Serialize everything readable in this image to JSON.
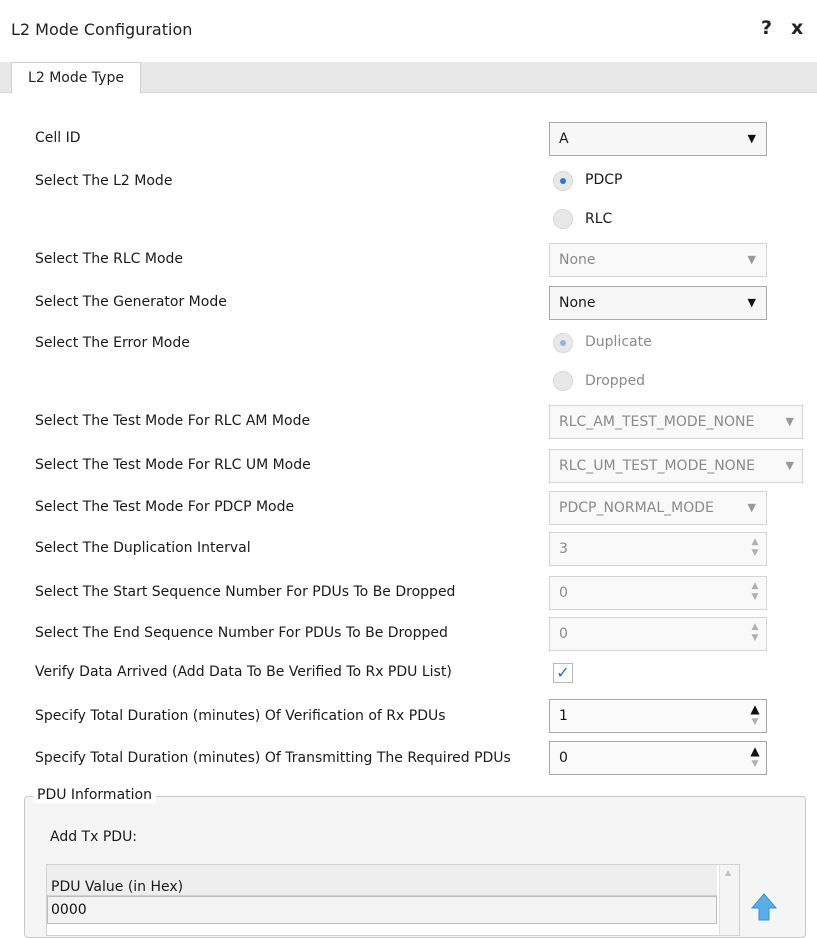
{
  "window": {
    "title": "L2 Mode Configuration",
    "help": "?",
    "close": "x"
  },
  "tabs": [
    {
      "label": "L2 Mode Type",
      "active": true
    }
  ],
  "form": {
    "cell_id": {
      "label": "Cell ID",
      "value": "A"
    },
    "l2_mode": {
      "label": "Select The L2 Mode",
      "options": [
        "PDCP",
        "RLC"
      ],
      "selected": "PDCP"
    },
    "rlc_mode": {
      "label": "Select The RLC Mode",
      "value": "None",
      "disabled": true
    },
    "generator_mode": {
      "label": "Select The Generator Mode",
      "value": "None"
    },
    "error_mode": {
      "label": "Select The Error Mode",
      "options": [
        "Duplicate",
        "Dropped"
      ],
      "selected": "Duplicate",
      "disabled": true
    },
    "rlc_am_test_mode": {
      "label": "Select The Test Mode For RLC AM Mode",
      "value": "RLC_AM_TEST_MODE_NONE",
      "disabled": true
    },
    "rlc_um_test_mode": {
      "label": "Select The Test Mode For RLC UM Mode",
      "value": "RLC_UM_TEST_MODE_NONE",
      "disabled": true
    },
    "pdcp_test_mode": {
      "label": "Select The Test Mode For PDCP Mode",
      "value": "PDCP_NORMAL_MODE",
      "disabled": true
    },
    "duplication_interval": {
      "label": "Select The Duplication Interval",
      "value": "3",
      "disabled": true
    },
    "start_seq": {
      "label": "Select The Start Sequence Number For PDUs To Be Dropped",
      "value": "0",
      "disabled": true
    },
    "end_seq": {
      "label": "Select The End Sequence Number For PDUs To Be Dropped",
      "value": "0",
      "disabled": true
    },
    "verify_data": {
      "label": "Verify Data Arrived (Add Data To Be Verified To Rx PDU List)",
      "checked": true,
      "mark": "✓"
    },
    "verification_duration": {
      "label": "Specify Total Duration (minutes) Of Verification of Rx PDUs",
      "value": "1"
    },
    "transmit_duration": {
      "label": "Specify Total Duration (minutes) Of Transmitting The Required PDUs",
      "value": "0"
    }
  },
  "pdu_info": {
    "legend": "PDU Information",
    "add_tx_label": "Add Tx PDU:",
    "table": {
      "columns": [
        "PDU Value (in Hex)"
      ],
      "rows": [
        [
          "0000"
        ]
      ]
    }
  },
  "colors": {
    "accent": "#2a78c6",
    "check": "#1f6fbf",
    "up_arrow": "#5aaee8"
  }
}
